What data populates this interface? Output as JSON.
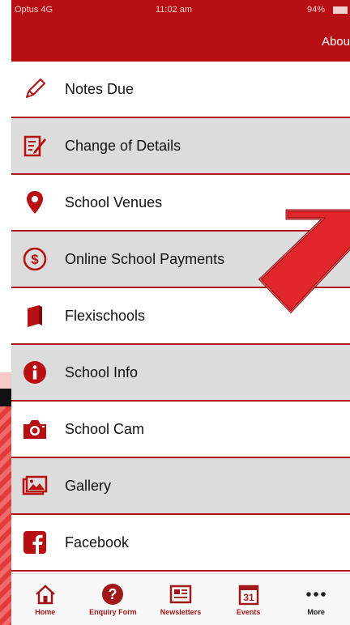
{
  "status_bar": {
    "carrier": "Optus 4G",
    "time": "11:02 am",
    "battery": "94%"
  },
  "nav_bar": {
    "right_label": "Abou"
  },
  "menu": [
    {
      "label": "Notes Due",
      "icon": "pencil-icon"
    },
    {
      "label": "Change of Details",
      "icon": "edit-document-icon"
    },
    {
      "label": "School Venues",
      "icon": "map-pin-icon"
    },
    {
      "label": "Online School Payments",
      "icon": "dollar-circle-icon"
    },
    {
      "label": "Flexischools",
      "icon": "book-icon"
    },
    {
      "label": "School Info",
      "icon": "info-icon"
    },
    {
      "label": "School Cam",
      "icon": "camera-icon"
    },
    {
      "label": "Gallery",
      "icon": "gallery-icon"
    },
    {
      "label": "Facebook",
      "icon": "facebook-icon"
    }
  ],
  "tab_bar": [
    {
      "label": "Home",
      "icon": "home-icon"
    },
    {
      "label": "Enquiry Form",
      "icon": "question-icon"
    },
    {
      "label": "Newsletters",
      "icon": "newspaper-icon"
    },
    {
      "label": "Events",
      "icon": "calendar-icon",
      "icon_text": "31"
    },
    {
      "label": "More",
      "icon": "more-icon"
    }
  ],
  "colors": {
    "brand_red": "#b80f12",
    "divider": "#b01a1e",
    "alt_row": "#dcdcdc",
    "arrow": "#e0262b"
  }
}
